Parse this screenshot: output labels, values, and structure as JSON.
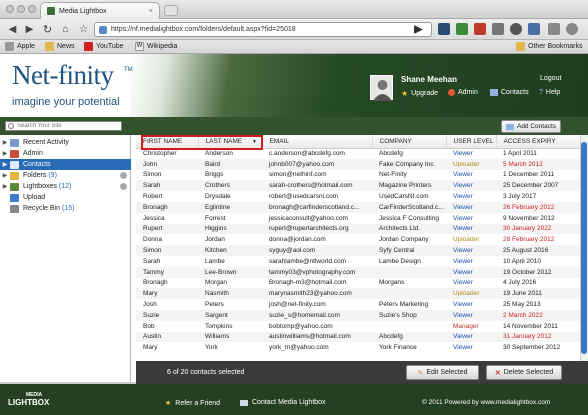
{
  "browser": {
    "tab_title": "Media Lightbox",
    "url": "https://nf.medialightbox.com/folders/default.aspx?fid=25018",
    "bookmarks": [
      "Apple",
      "News",
      "YouTube",
      "Wikipedia"
    ],
    "other_bookmarks": "Other Bookmarks"
  },
  "header": {
    "logo_name": "Net-finity",
    "logo_tm": "TM",
    "logo_tagline": "imagine your potential",
    "user_name": "Shane Meehan",
    "logout": "Logout",
    "links": [
      "Upgrade",
      "Admin",
      "Contacts",
      "Help"
    ]
  },
  "sidebar": {
    "search_placeholder": "Search Your Site",
    "items": [
      {
        "label": "Recent Activity",
        "count": "",
        "color": "#7a9bc9"
      },
      {
        "label": "Admin",
        "count": "",
        "color": "#c94d3a"
      },
      {
        "label": "Contacts",
        "count": "",
        "color": "#4a7fc1"
      },
      {
        "label": "Folders",
        "count": "(9)",
        "color": "#e3b33a"
      },
      {
        "label": "Lightboxes",
        "count": "(12)",
        "color": "#5a8a3c"
      },
      {
        "label": "Upload",
        "count": "",
        "color": "#3b7bd0"
      },
      {
        "label": "Recycle Bin",
        "count": "(15)",
        "color": "#888888"
      }
    ]
  },
  "main": {
    "add_contacts": "Add Contacts",
    "columns": [
      "FIRST NAME",
      "LAST NAME",
      "EMAIL",
      "COMPANY",
      "USER LEVEL",
      "ACCESS EXPIRY"
    ],
    "rows": [
      [
        "Christopher",
        "Anderson",
        "c.anderson@abcdefg.com",
        "Abcdefg",
        "Viewer",
        "1 April 2011"
      ],
      [
        "John",
        "Baird",
        "johnb007@yahoo.com",
        "Fake Company Inc.",
        "Uploader",
        "5 March 2012"
      ],
      [
        "Simon",
        "Briggs",
        "simon@nethinf.com",
        "Net-Finity",
        "Viewer",
        "1 December 2011"
      ],
      [
        "Sarah",
        "Crothers",
        "sarah-crothers@hotmail.com",
        "Magazine Printers",
        "Viewer",
        "25 December 2007"
      ],
      [
        "Robert",
        "Drysdale",
        "robert@usedcarsni.com",
        "UsedCarsNI.com",
        "Viewer",
        "3 July 2017"
      ],
      [
        "Bronagh",
        "Eglintine",
        "bronagh@carfinderscotland.c...",
        "CarFinderScotland.c...",
        "Viewer",
        "26 February 2012"
      ],
      [
        "Jessica",
        "Forrest",
        "jessicaconsult@yahoo.com",
        "Jessica F Consulting",
        "Viewer",
        "9 November 2012"
      ],
      [
        "Rupert",
        "Higgins",
        "rupert@rupertarchitects.org",
        "Architects Ltd.",
        "Viewer",
        "30 January 2022"
      ],
      [
        "Donna",
        "Jordan",
        "donna@jordan.com",
        "Jordan Company",
        "Uploader",
        "28 February 2012"
      ],
      [
        "Simon",
        "Kitchen",
        "syguy@aol.com",
        "Syfy Central",
        "Viewer",
        "25 August 2016"
      ],
      [
        "Sarah",
        "Lambe",
        "sarahlambe@ntlworld.com",
        "Lambe Design",
        "Viewer",
        "10 April 2010"
      ],
      [
        "Tammy",
        "Lee-Brown",
        "tammy03@vphotography.com",
        "",
        "Viewer",
        "19 October 2012"
      ],
      [
        "Bronagh",
        "Morgan",
        "Bronagh-m3@hotmail.com",
        "Morgans",
        "Viewer",
        "4 July 2016"
      ],
      [
        "Mary",
        "Nasmith",
        "marynasmith23@yahoo.com",
        "",
        "Uploader",
        "19 June 2011"
      ],
      [
        "Josh",
        "Peters",
        "josh@net-finity.com",
        "Peters Marketing",
        "Viewer",
        "25 May 2013"
      ],
      [
        "Suzie",
        "Sargent",
        "suzie_s@homemail.com",
        "Suzie's Shop",
        "Viewer",
        "2 March 2022"
      ],
      [
        "Bob",
        "Tompkins",
        "bobtomp@yahoo.com",
        "",
        "Manager",
        "14 November 2011"
      ],
      [
        "Austin",
        "Williams",
        "austinwilliams@hotmail.com",
        "Abcdefg",
        "Viewer",
        "31 January 2012"
      ],
      [
        "Mary",
        "York",
        "york_m@yahoo.com",
        "York Finance",
        "Viewer",
        "30 September 2012"
      ]
    ],
    "expiry_red_rows": [
      1,
      5,
      7,
      8,
      15,
      17
    ],
    "selection_text": "6 of 20 contacts selected",
    "edit_selected": "Edit Selected",
    "delete_selected": "Delete Selected"
  },
  "footer": {
    "logo_top": "MEDIA",
    "logo_bottom": "LIGHTBOX",
    "refer": "Refer a Friend",
    "contact": "Contact Media Lightbox",
    "copyright": "© 2011 Powered by www.medialightbox.com"
  },
  "colors": {
    "brand_blue": "#1f5480",
    "header_green": "#264a25",
    "highlight_red": "#d11b1b",
    "selection_blue": "#2a6bb7"
  }
}
